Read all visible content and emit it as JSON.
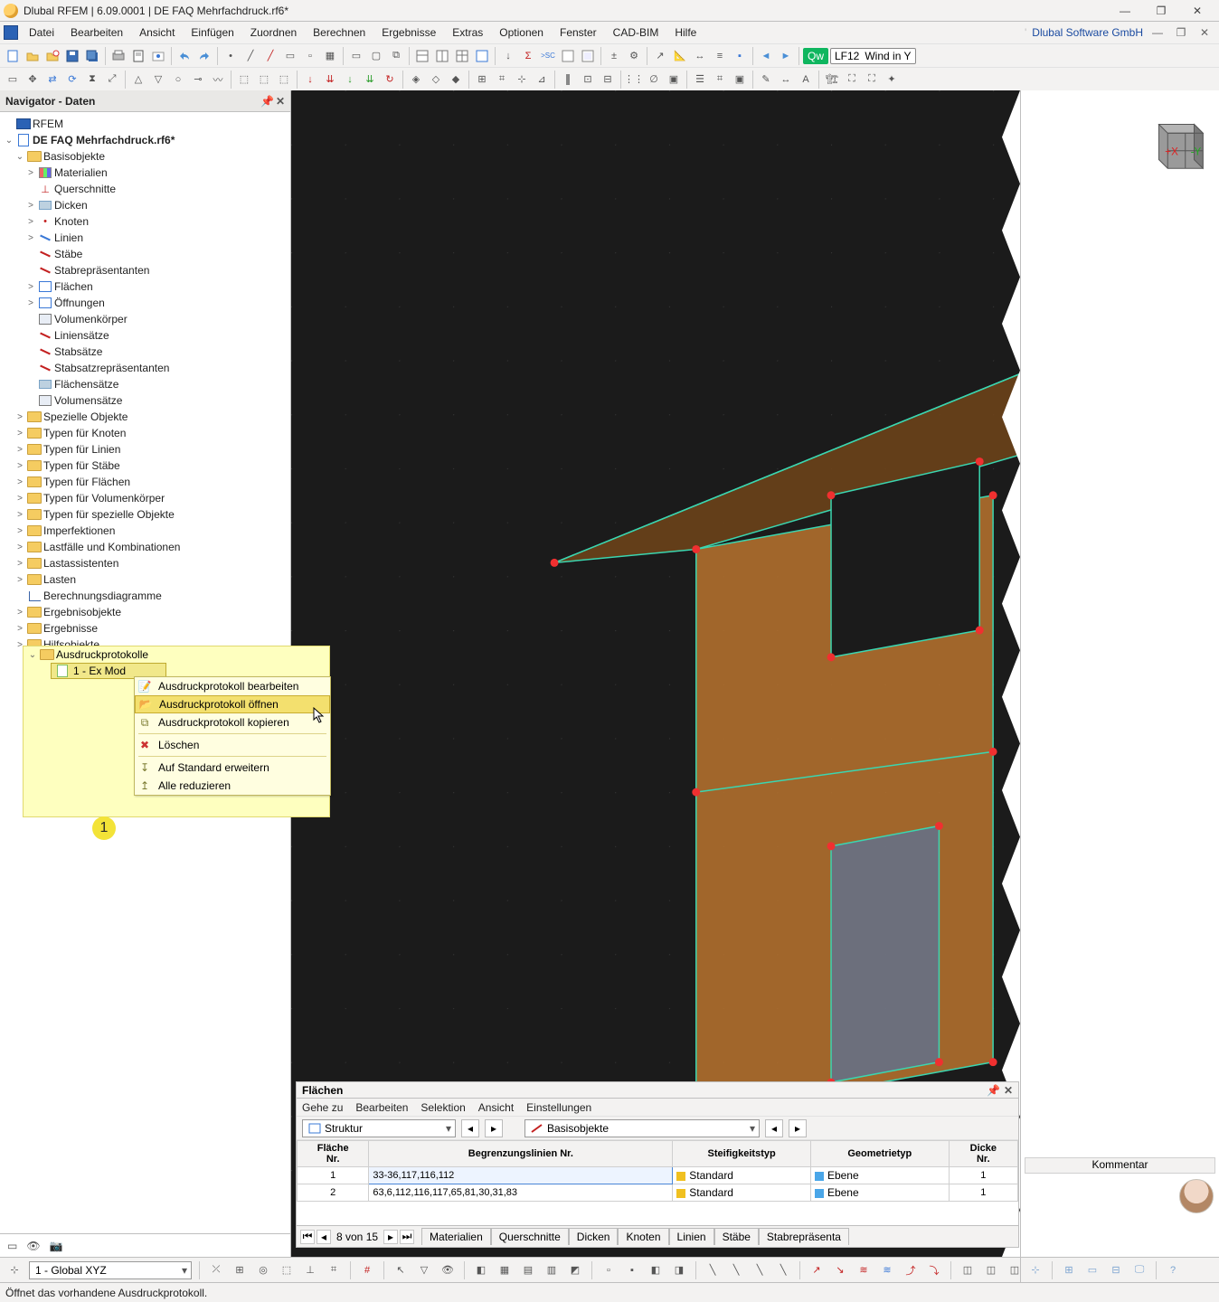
{
  "title": "Dlubal RFEM | 6.09.0001 | DE FAQ Mehrfachdruck.rf6*",
  "company": "Dlubal Software GmbH",
  "menus": [
    "Datei",
    "Bearbeiten",
    "Ansicht",
    "Einfügen",
    "Zuordnen",
    "Berechnen",
    "Ergebnisse",
    "Extras",
    "Optionen",
    "Fenster",
    "CAD-BIM",
    "Hilfe"
  ],
  "toolbar1": {
    "qw": "Qw",
    "lf": "LF12",
    "lf_label": "Wind in Y"
  },
  "navigator": {
    "panel_title": "Navigator - Daten",
    "root": "RFEM",
    "file": "DE FAQ Mehrfachdruck.rf6*",
    "basis": "Basisobjekte",
    "basis_children": [
      {
        "label": "Materialien",
        "icon": "mats",
        "twist": ">"
      },
      {
        "label": "Querschnitte",
        "icon": "prof",
        "twist": ""
      },
      {
        "label": "Dicken",
        "icon": "filegrey",
        "twist": ">"
      },
      {
        "label": "Knoten",
        "icon": "dot",
        "twist": ">"
      },
      {
        "label": "Linien",
        "icon": "line",
        "twist": ">"
      },
      {
        "label": "Stäbe",
        "icon": "line2",
        "twist": ""
      },
      {
        "label": "Stabrepräsentanten",
        "icon": "line2",
        "twist": ""
      },
      {
        "label": "Flächen",
        "icon": "rect",
        "twist": ">"
      },
      {
        "label": "Öffnungen",
        "icon": "rect",
        "twist": ">"
      },
      {
        "label": "Volumenkörper",
        "icon": "box3d",
        "twist": ""
      },
      {
        "label": "Liniensätze",
        "icon": "line2",
        "twist": ""
      },
      {
        "label": "Stabsätze",
        "icon": "line2",
        "twist": ""
      },
      {
        "label": "Stabsatzrepräsentanten",
        "icon": "line2",
        "twist": ""
      },
      {
        "label": "Flächensätze",
        "icon": "filegrey",
        "twist": ""
      },
      {
        "label": "Volumensätze",
        "icon": "box3d",
        "twist": ""
      }
    ],
    "top_nodes": [
      "Spezielle Objekte",
      "Typen für Knoten",
      "Typen für Linien",
      "Typen für Stäbe",
      "Typen für Flächen",
      "Typen für Volumenkörper",
      "Typen für spezielle Objekte",
      "Imperfektionen",
      "Lastfälle und Kombinationen",
      "Lastassistenten",
      "Lasten"
    ],
    "misc_nodes": [
      {
        "label": "Berechnungsdiagramme",
        "icon": "chart"
      }
    ],
    "folder_nodes": [
      "Ergebnisobjekte",
      "Ergebnisse",
      "Hilfsobjekte"
    ],
    "reports_label": "Ausdruckprotokolle",
    "report_item": "1 - Ex Mod",
    "context": [
      "Ausdruckprotokoll bearbeiten",
      "Ausdruckprotokoll öffnen",
      "Ausdruckprotokoll kopieren",
      "Löschen",
      "Auf Standard erweitern",
      "Alle reduzieren"
    ],
    "badge": "1"
  },
  "bottom": {
    "title": "Flächen",
    "menu": [
      "Gehe zu",
      "Bearbeiten",
      "Selektion",
      "Ansicht",
      "Einstellungen"
    ],
    "combo1": "Struktur",
    "combo2": "Basisobjekte",
    "columns": [
      "Fläche\nNr.",
      "Begrenzungslinien Nr.",
      "Steifigkeitstyp",
      "Geometrietyp",
      "Dicke\nNr."
    ],
    "rows": [
      {
        "nr": "1",
        "lines": "33-36,117,116,112",
        "stiff": "Standard",
        "stiff_color": "#f0c020",
        "geom": "Ebene",
        "geom_color": "#4aa6e8",
        "dicke": "1"
      },
      {
        "nr": "2",
        "lines": "63,6,112,116,117,65,81,30,31,83",
        "stiff": "Standard",
        "stiff_color": "#f0c020",
        "geom": "Ebene",
        "geom_color": "#4aa6e8",
        "dicke": "1"
      }
    ],
    "pager": "8 von 15",
    "tabs": [
      "Materialien",
      "Querschnitte",
      "Dicken",
      "Knoten",
      "Linien",
      "Stäbe",
      "Stabrepräsenta"
    ],
    "kommentar": "Kommentar"
  },
  "statusbar": {
    "coords": "1 - Global XYZ",
    "message": "Öffnet das vorhandene Ausdruckprotokoll."
  }
}
